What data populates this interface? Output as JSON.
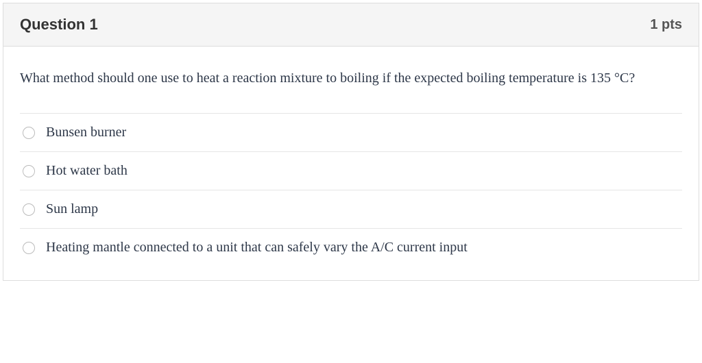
{
  "header": {
    "title": "Question 1",
    "points": "1 pts"
  },
  "question": {
    "text": "What method should one use to heat a reaction mixture to boiling if the expected boiling temperature is 135 °C?"
  },
  "answers": [
    {
      "label": "Bunsen burner"
    },
    {
      "label": "Hot water bath"
    },
    {
      "label": "Sun lamp"
    },
    {
      "label": "Heating mantle connected to a unit that can safely vary the A/C current input"
    }
  ]
}
